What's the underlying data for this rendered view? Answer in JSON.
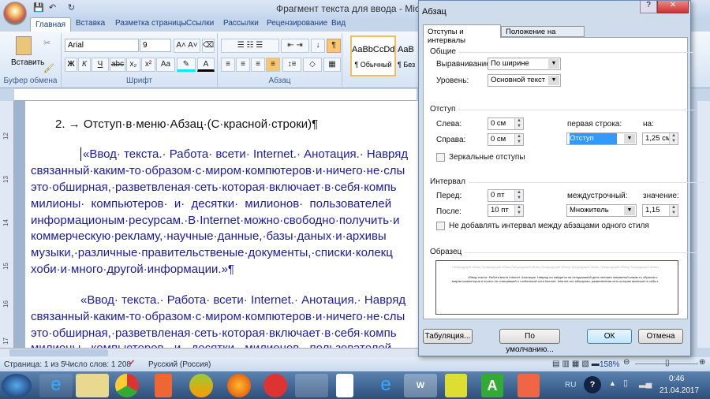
{
  "window": {
    "title": "Фрагмент текста для ввода - Microsoft Word"
  },
  "ribbon": {
    "tabs": [
      "Главная",
      "Вставка",
      "Разметка страницы",
      "Ссылки",
      "Рассылки",
      "Рецензирование",
      "Вид"
    ],
    "clipboard": {
      "paste": "Вставить",
      "label": "Буфер обмена"
    },
    "font": {
      "name": "Arial",
      "size": "9",
      "label": "Шрифт",
      "bold": "Ж",
      "italic": "К",
      "underline": "Ч",
      "strike": "abc",
      "sub": "x₂",
      "sup": "x²",
      "case": "Aa"
    },
    "paragraph": {
      "label": "Абзац",
      "pilcrow": "¶"
    },
    "styles": [
      {
        "preview": "AaBbCcDd",
        "name": "¶ Обычный"
      },
      {
        "preview": "AaB",
        "name": "¶ Без"
      }
    ]
  },
  "document": {
    "heading": "2. → Отступ·в·меню·Абзац·(С·красной·строки)¶",
    "para1": [
      "«Ввод· текста.· Работа· всети· Internet.· Анотация.· Навряд",
      "связанный·каким-то·образом·с·миром·компютеров·и·ничего·не·слы",
      "это·обширная,·разветвленая·сеть·которая·включает·в·себя·компь",
      "милионы·  компьютеров·  и·  десятки·  милионов·  пользователей",
      "информационым·ресурсам.·В·Internet·можно·свободно·получить·и",
      "коммерческую·рекламу,·научные·данные,·базы·даных·и·архивы",
      "музыки,·различные·правительственые·документы,·списки·колекц",
      "хоби·и·много·другой·информации.»¶"
    ],
    "para2": [
      "«Ввод· текста.· Работа· всети· Internet.· Анотация.· Навряд",
      "связанный·каким-то·образом·с·миром·компютеров·и·ничего·не·слы",
      "это·обширная,·разветвленая·сеть·которая·включает·в·себя·компь",
      "милионы·  компьютеров·  и·  десятки·  милионов·  пользователей"
    ],
    "vruler": [
      "12",
      "13",
      "14",
      "15",
      "16",
      "17"
    ]
  },
  "status": {
    "page": "Страница: 1 из 5",
    "words": "Число слов: 1 208",
    "language": "Русский (Россия)",
    "zoom": "158%"
  },
  "tray": {
    "lang": "RU",
    "time": "0:46",
    "date": "21.04.2017"
  },
  "dialog": {
    "title": "Абзац",
    "help": "?",
    "close": "✕",
    "tabs": [
      "Отступы и интервалы",
      "Положение на странице"
    ],
    "general": {
      "label": "Общие",
      "alignment_label": "Выравнивание:",
      "alignment": "По ширине",
      "level_label": "Уровень:",
      "level": "Основной текст"
    },
    "indent": {
      "label": "Отступ",
      "left_label": "Слева:",
      "left": "0 см",
      "right_label": "Справа:",
      "right": "0 см",
      "first_label": "первая строка:",
      "first": "Отступ",
      "by_label": "на:",
      "by": "1,25 см",
      "mirror": "Зеркальные отступы"
    },
    "spacing": {
      "label": "Интервал",
      "before_label": "Перед:",
      "before": "0 пт",
      "after_label": "После:",
      "after": "10 пт",
      "line_label": "междустрочный:",
      "line": "Множитель",
      "value_label": "значение:",
      "value": "1,15",
      "nodup": "Не добавлять интервал между абзацами одного стиля"
    },
    "sample": {
      "label": "Образец",
      "prev": "Предыдущий абзац Предыдущий абзац Предыдущий абзац Предыдущий абзац Предыдущий абзац Предыдущий абзац Предыдущий абзац",
      "text": "«Ввод текста. Работа всети Internet. Анотация. Навряд ли найдется на сегодняшний день человек связанный каким-то образом с миром компютеров и ничего не слышавший о глобальной сети Internet. Internet-это обширная, разветвленая сеть которая включает в себя к"
    },
    "buttons": {
      "tabs": "Табуляция...",
      "default": "По умолчанию...",
      "ok": "ОК",
      "cancel": "Отмена"
    }
  }
}
